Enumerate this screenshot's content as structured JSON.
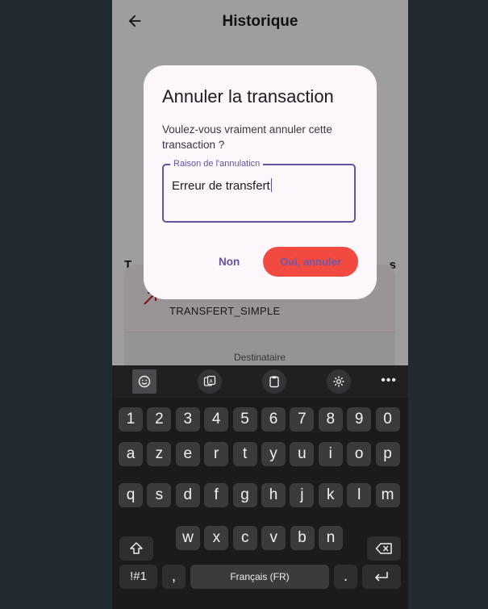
{
  "app": {
    "title": "Historique",
    "section_title": "T",
    "section_title_end": "s",
    "transaction": {
      "type": "TRANSFERT_SIMPLE",
      "recipient_label": "Destinataire"
    }
  },
  "dialog": {
    "title": "Annuler la transaction",
    "message": "Voulez-vous vraiment annuler cette transaction ?",
    "reason_field": {
      "label": "Raison de l'annulaticn",
      "value": "Erreur de transfert"
    },
    "cancel_label": "Non",
    "confirm_label": "Oui, annuler"
  },
  "keyboard": {
    "toolbar": [
      "emoji-icon",
      "clipboard-translate-icon",
      "clipboard-icon",
      "settings-icon"
    ],
    "more_label": "•••",
    "row_numbers": [
      "1",
      "2",
      "3",
      "4",
      "5",
      "6",
      "7",
      "8",
      "9",
      "0"
    ],
    "row_1": [
      "a",
      "z",
      "e",
      "r",
      "t",
      "y",
      "u",
      "i",
      "o",
      "p"
    ],
    "row_2": [
      "q",
      "s",
      "d",
      "f",
      "g",
      "h",
      "j",
      "k",
      "l",
      "m"
    ],
    "row_3": [
      "w",
      "x",
      "c",
      "v",
      "b",
      "n"
    ],
    "symbols_label": "!#1",
    "comma_label": ",",
    "space_label": "Français (FR)",
    "period_label": ".",
    "colors": {
      "key": "#3b3b3e",
      "background": "#1b1b1d"
    }
  },
  "colors": {
    "accent": "#6750a4",
    "confirm_button": "#f24a41",
    "dialog_bg": "#fdf6fb"
  }
}
